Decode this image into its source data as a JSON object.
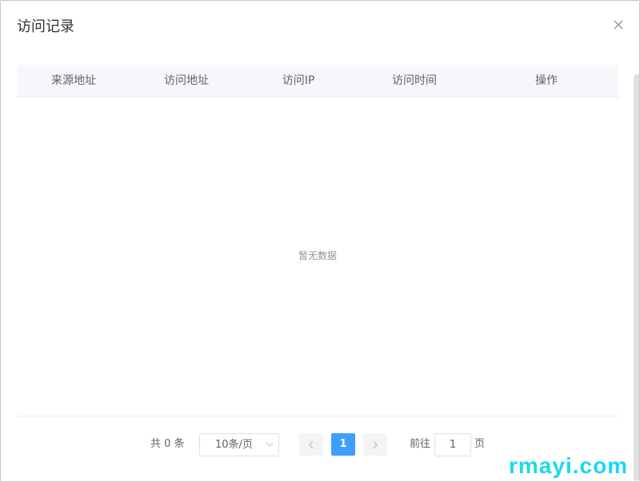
{
  "dialog": {
    "title": "访问记录",
    "close_icon": "close-icon"
  },
  "table": {
    "columns": [
      "来源地址",
      "访问地址",
      "访问IP",
      "访问时间",
      "操作"
    ],
    "rows": [],
    "empty_text": "暂无数据"
  },
  "pagination": {
    "total_text": "共 0 条",
    "page_size_label": "10条/页",
    "current_page": "1",
    "jump_prefix": "前往",
    "jump_value": "1",
    "jump_suffix": "页",
    "prev_icon": "chevron-left-icon",
    "next_icon": "chevron-right-icon"
  },
  "colors": {
    "accent": "#409eff",
    "header_bg": "#f5f7fa",
    "watermark": "#19d9f0"
  },
  "watermark": "rmayi.com"
}
